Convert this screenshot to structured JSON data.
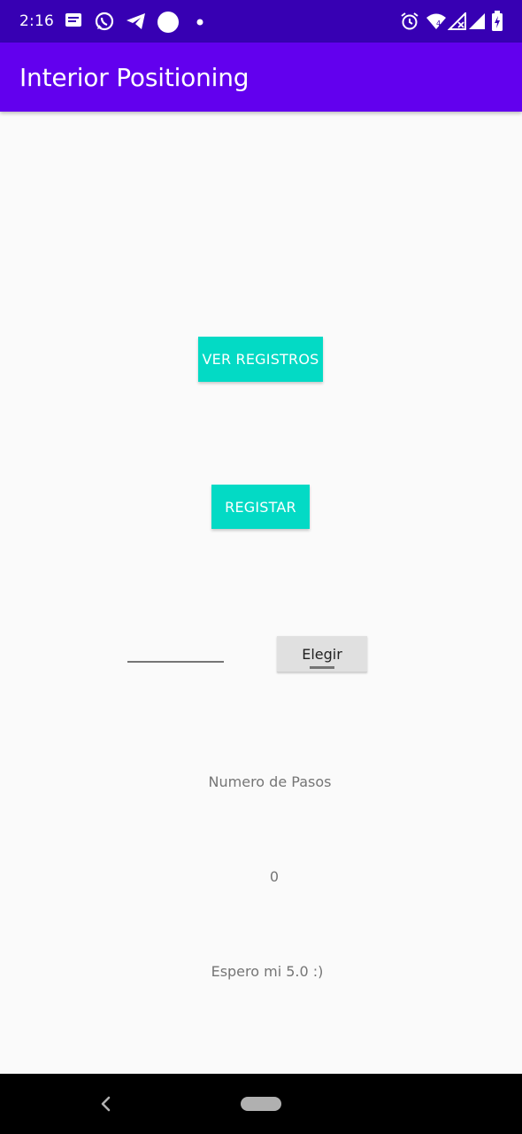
{
  "status_bar": {
    "time": "2:16",
    "icons_left": [
      "message-icon",
      "whatsapp-icon",
      "telegram-icon",
      "circle-icon",
      "dot-icon"
    ],
    "icons_right": [
      "alarm-icon",
      "wifi-icon",
      "signal-icon",
      "signal-full-icon",
      "battery-icon"
    ]
  },
  "app_bar": {
    "title": "Interior Positioning"
  },
  "main": {
    "ver_registros_label": "VER REGISTROS",
    "registar_label": "REGISTAR",
    "edit_value": "",
    "elegir_label": "Elegir",
    "steps_label": "Numero de Pasos",
    "steps_count": "0",
    "footer_text": "Espero mi 5.0 :)"
  },
  "colors": {
    "status_bar": "#3700b3",
    "app_bar": "#6200ee",
    "accent": "#03dac5",
    "background": "#fafafa"
  },
  "nav_bar": {
    "icons": [
      "back-icon",
      "home-pill-icon"
    ]
  }
}
